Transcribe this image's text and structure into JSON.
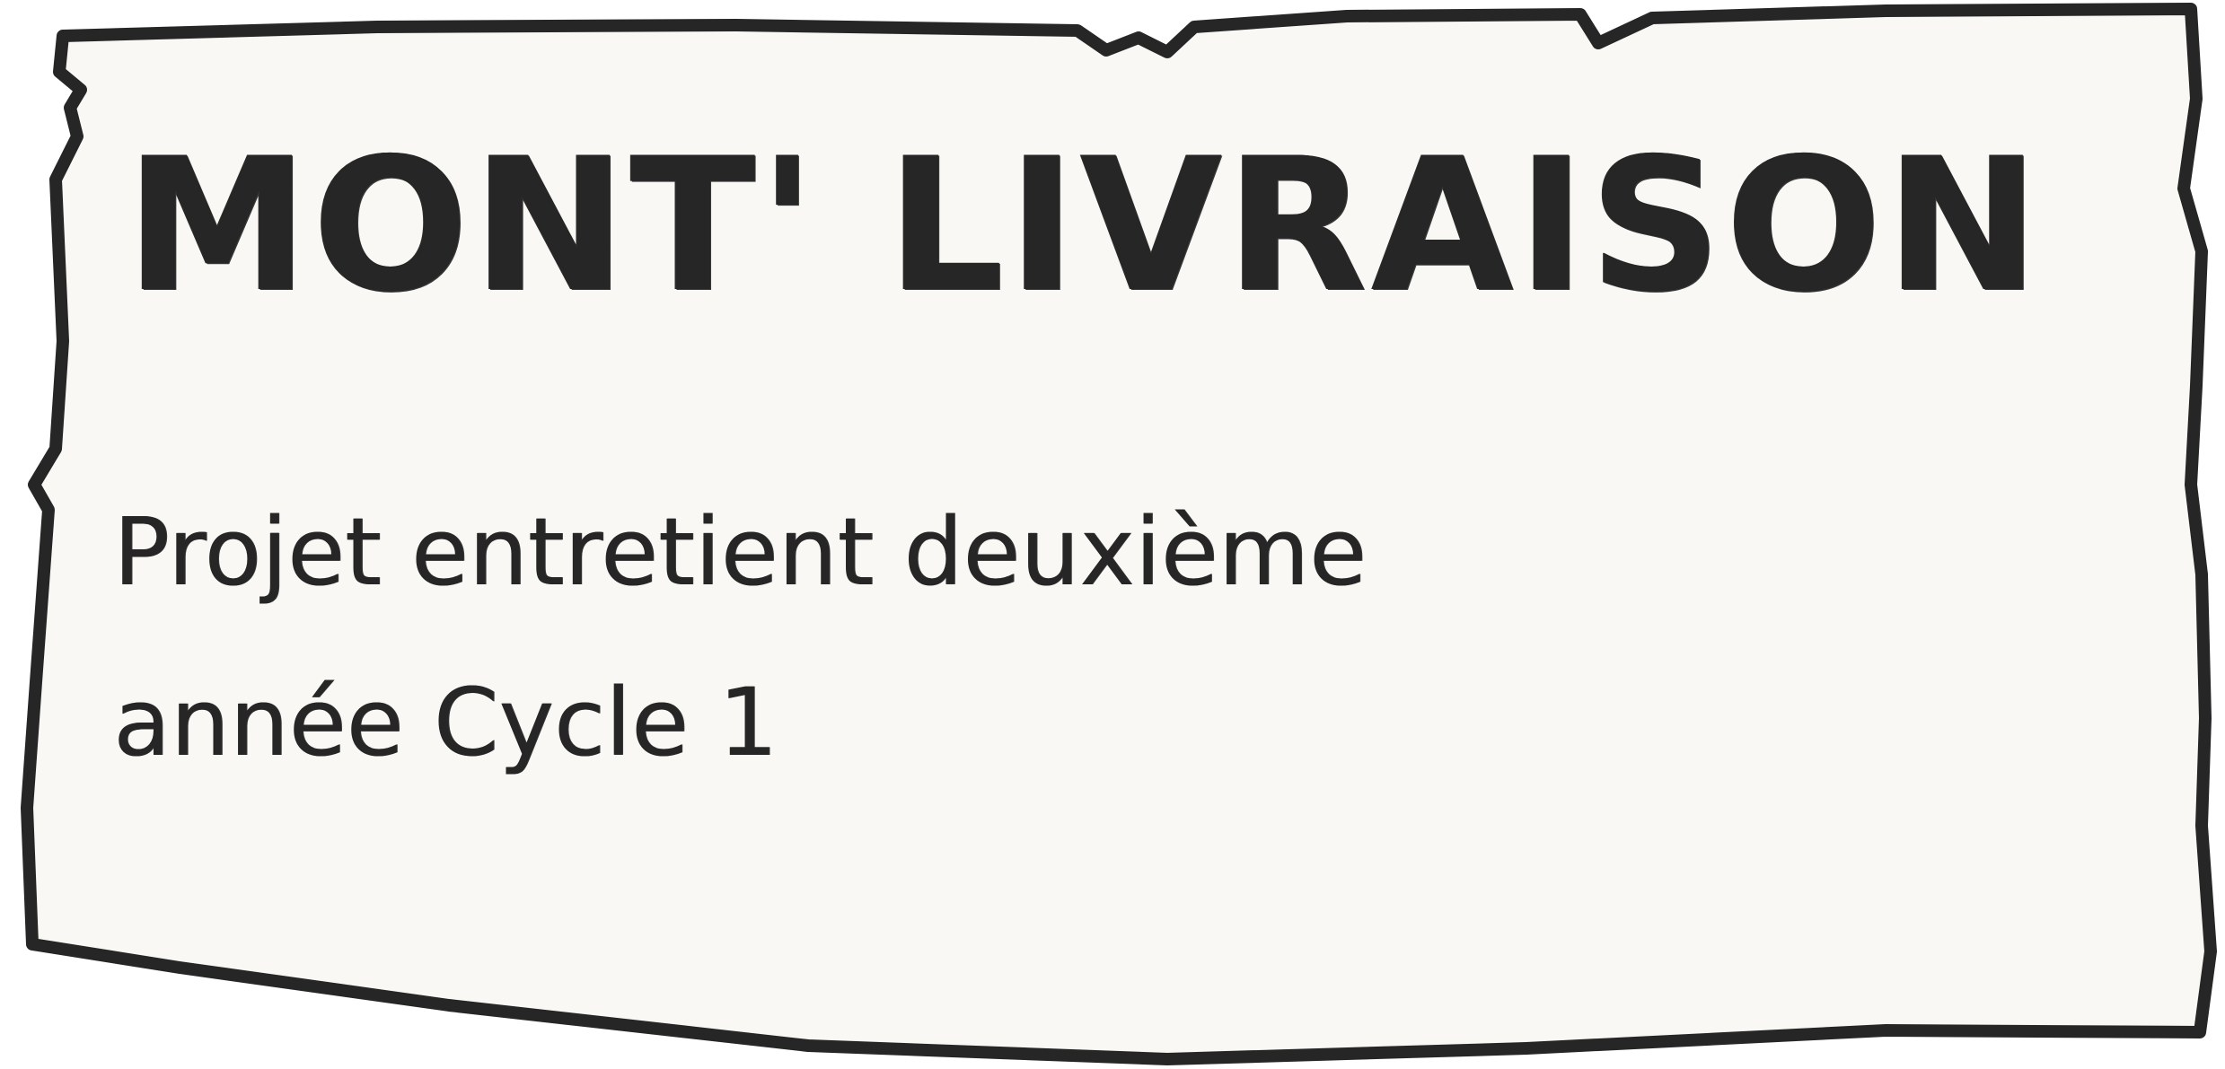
{
  "card": {
    "title": "MONT' LIVRAISON",
    "subtitle": "Projet entretient deuxième année Cycle 1",
    "background_color": "#f9f8f4",
    "ink_color": "#262626"
  }
}
